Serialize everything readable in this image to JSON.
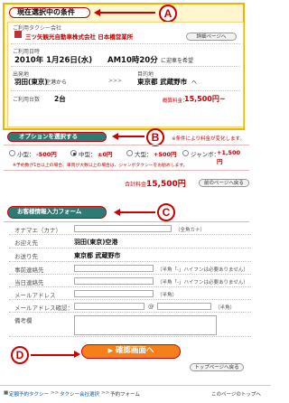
{
  "sectionA": {
    "title": "現在選択中の条件",
    "company_label": "ご利用タクシー会社",
    "company_name": "三ツ矢観光自動車株式会社 日本橋営業所",
    "detail_button": "詳細ページへ",
    "datetime_label": "ご利用日時",
    "date": "2010年 1月26日(水)",
    "time": "AM10時20分",
    "time_suffix": "に迎車を希望",
    "from_label": "出発地",
    "from_value": "羽田(東京)",
    "from_suffix": "空港から",
    "arrow": ">>>",
    "to_label": "目的地",
    "to_value": "東京都 武蔵野市",
    "to_suffix": "へ",
    "count_label": "ご利用台数",
    "count_value": "2台",
    "estimate_label": "概算料金：",
    "estimate_value": "15,500円~"
  },
  "markers": {
    "a": "A",
    "b": "B",
    "c": "C",
    "d": "D"
  },
  "sectionB": {
    "pill": "オプションを選択する",
    "notice": "※条件により料金が変化します。",
    "options": [
      {
        "label": "小型：",
        "price": "-500円",
        "selected": false
      },
      {
        "label": "中型：",
        "price": "±0円",
        "selected": true
      },
      {
        "label": "大型：",
        "price": "+500円",
        "selected": false
      },
      {
        "label": "ジャンボ：",
        "price": "+1,500円",
        "selected": false
      }
    ],
    "note": "※予約数が1台以上の場合、車両が大数以上の場合は、ジャンボタクシーをお勧めします。",
    "total_label": "合計料金：",
    "total_value": "15,500円",
    "back_button": "前のページへ戻る"
  },
  "sectionC": {
    "pill": "お客様情報入力フォーム",
    "rows": [
      {
        "label": "オナマエ（カナ）",
        "value": "",
        "hint": "（全角カナ）"
      },
      {
        "label": "お迎え先",
        "value": "羽田(東京)空港",
        "hint": ""
      },
      {
        "label": "お送り先",
        "value": "東京都 武蔵野市",
        "hint": ""
      },
      {
        "label": "事前連絡先",
        "value": "",
        "hint": "（半角「-」ハイフンは必要ありません）"
      },
      {
        "label": "当日連絡先",
        "value": "",
        "hint": "（半角「-」ハイフンは必要ありません）"
      },
      {
        "label": "メールアドレス",
        "value": "",
        "hint": "（半角）"
      },
      {
        "label": "メールアドレス確認：",
        "value": "",
        "hint": "（半角）"
      },
      {
        "label": "備考欄",
        "value": "",
        "hint": ""
      }
    ],
    "at_mark": "@"
  },
  "sectionD": {
    "confirm_button": "確認画面へ",
    "top_button": "トップページへ戻る"
  },
  "footer": {
    "crumb1": "定額予約タクシー",
    "sep": ">>",
    "crumb2": "タクシー会社選択",
    "crumb3": "予約フォーム",
    "top_link": "このページのトップへ"
  },
  "colors": {
    "accent": "#cc0000",
    "teal": "#2e7a75",
    "orange": "#f57f1a",
    "yellow_border": "#f0b400"
  }
}
